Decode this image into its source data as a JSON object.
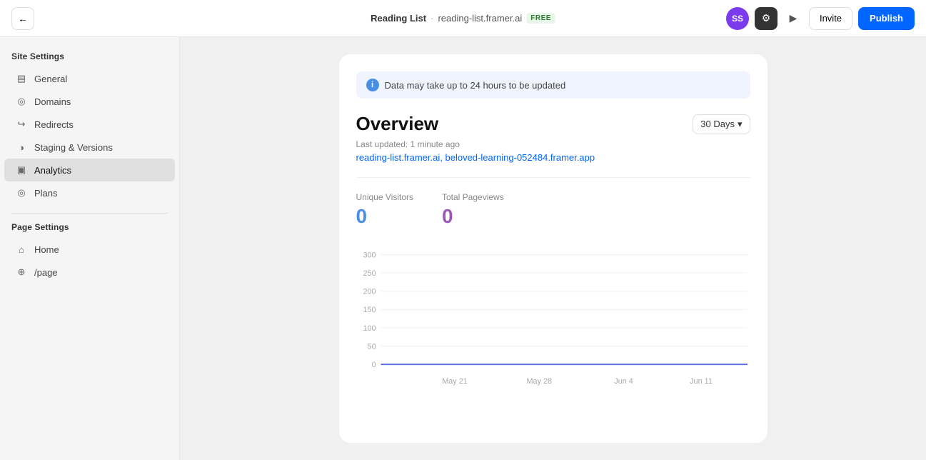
{
  "topbar": {
    "back_label": "←",
    "site_name": "Reading List",
    "dot": "·",
    "domain": "reading-list.framer.ai",
    "free_badge": "FREE",
    "avatar_initials": "SS",
    "gear_icon": "⚙",
    "play_icon": "▶",
    "invite_label": "Invite",
    "publish_label": "Publish"
  },
  "sidebar": {
    "site_settings_title": "Site Settings",
    "page_settings_title": "Page Settings",
    "items": [
      {
        "id": "general",
        "label": "General",
        "icon": "▤"
      },
      {
        "id": "domains",
        "label": "Domains",
        "icon": "◎"
      },
      {
        "id": "redirects",
        "label": "Redirects",
        "icon": "↪"
      },
      {
        "id": "staging",
        "label": "Staging & Versions",
        "icon": "◑"
      },
      {
        "id": "analytics",
        "label": "Analytics",
        "icon": "▣",
        "active": true
      },
      {
        "id": "plans",
        "label": "Plans",
        "icon": "◎"
      }
    ],
    "page_items": [
      {
        "id": "home",
        "label": "Home",
        "icon": "⌂"
      },
      {
        "id": "page",
        "label": "/page",
        "icon": "⊕"
      }
    ]
  },
  "analytics": {
    "info_banner": "Data may take up to 24 hours to be updated",
    "info_icon": "i",
    "overview_title": "Overview",
    "days_selector": "30 Days",
    "last_updated": "Last updated: 1 minute ago",
    "domain_links": "reading-list.framer.ai, beloved-learning-052484.framer.app",
    "unique_visitors_label": "Unique Visitors",
    "unique_visitors_value": "0",
    "total_pageviews_label": "Total Pageviews",
    "total_pageviews_value": "0",
    "chart": {
      "y_labels": [
        "300",
        "250",
        "200",
        "150",
        "100",
        "50",
        "0"
      ],
      "x_labels": [
        "May 21",
        "May 28",
        "Jun 4",
        "Jun 11"
      ]
    }
  }
}
